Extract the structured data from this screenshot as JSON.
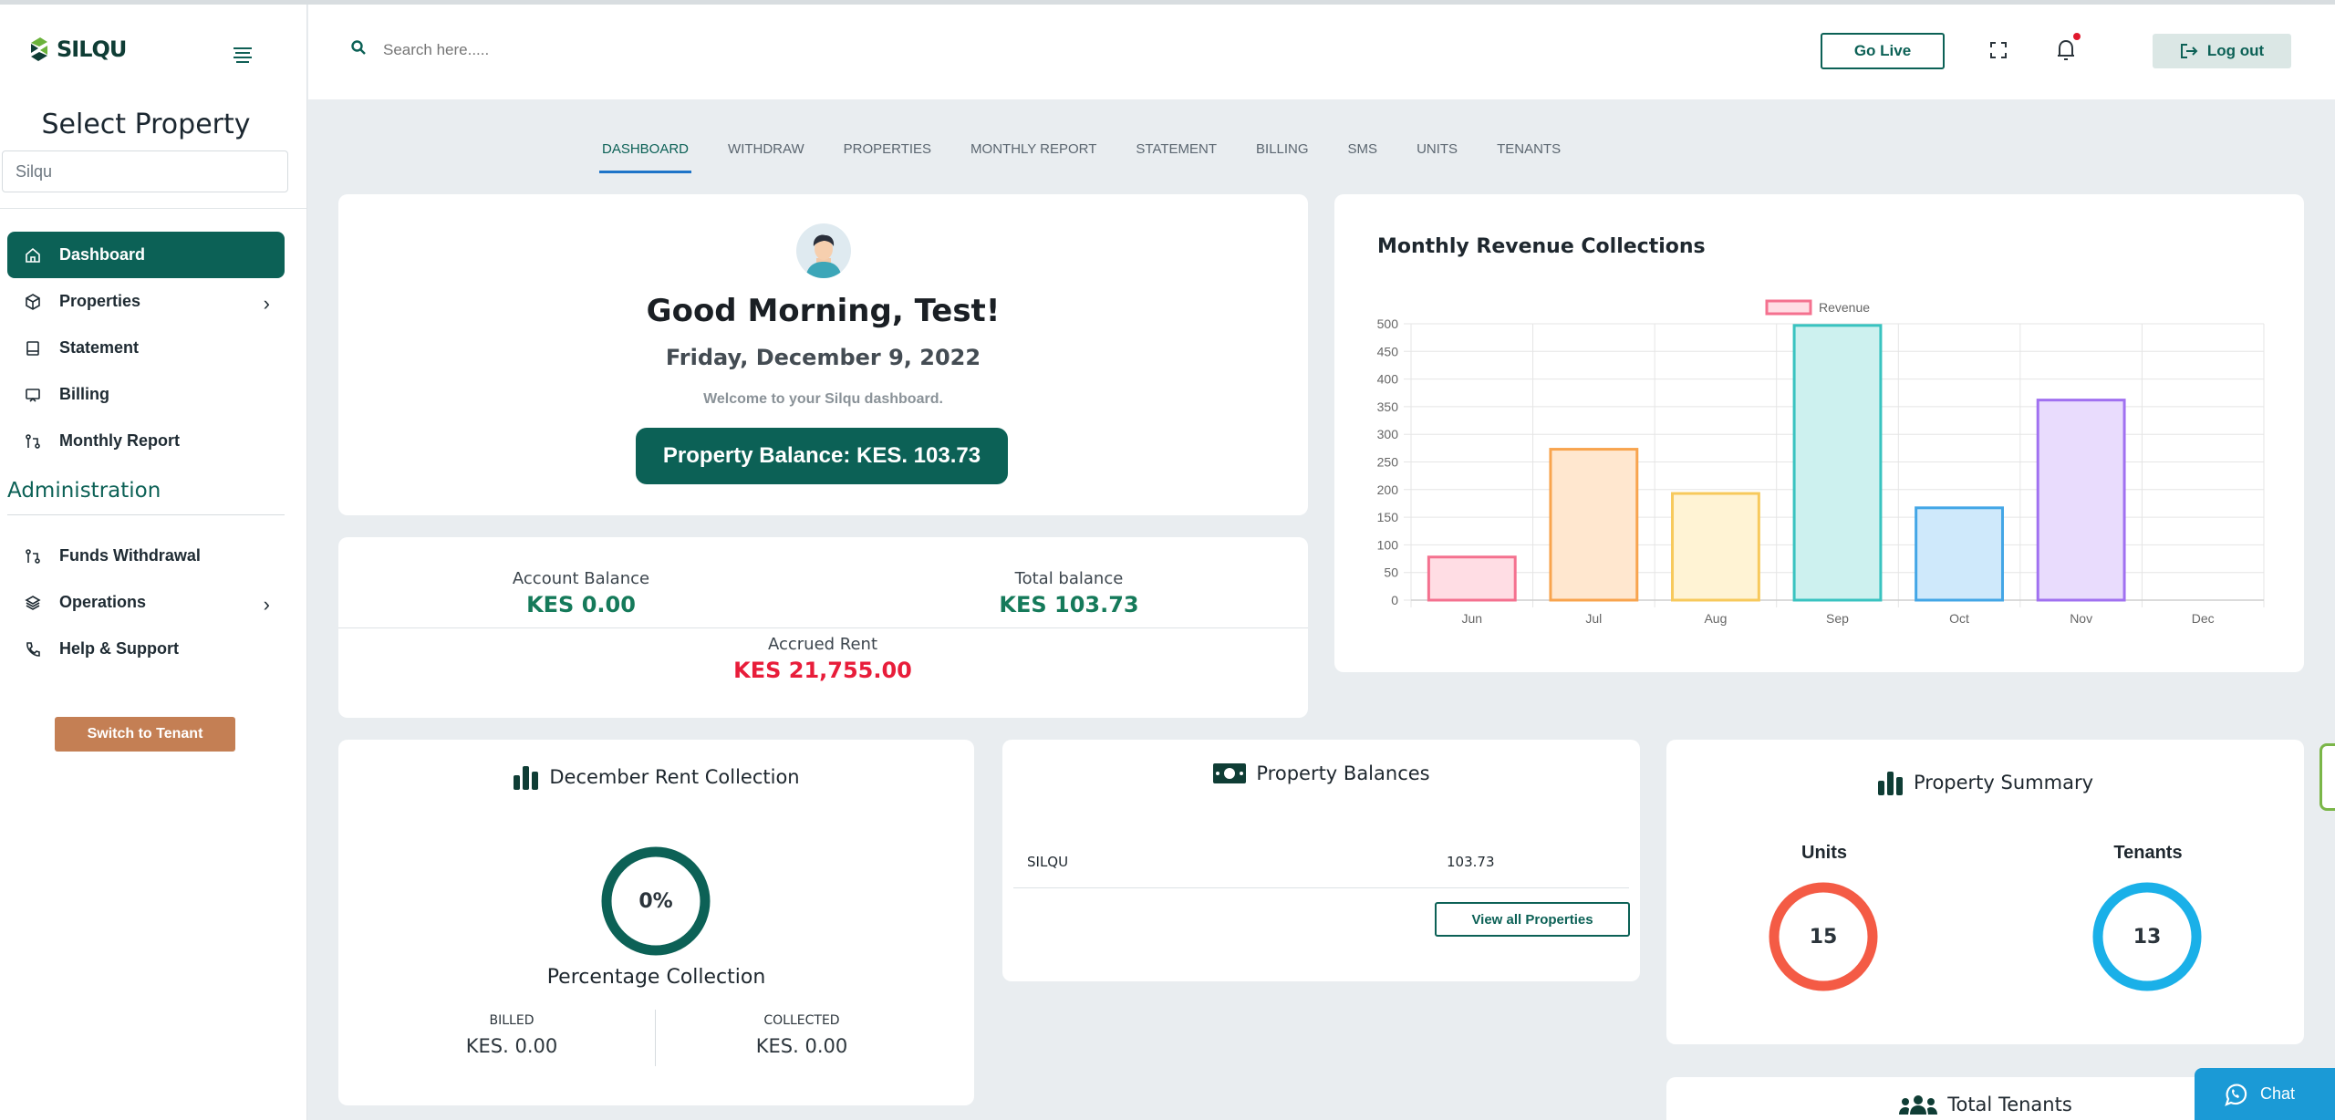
{
  "brand": {
    "name": "SILQU",
    "tagline": ""
  },
  "sidebar": {
    "select_title": "Select Property",
    "property_input_value": "Silqu",
    "nav": [
      {
        "label": "Dashboard",
        "icon": "home-icon"
      },
      {
        "label": "Properties",
        "icon": "box-icon"
      },
      {
        "label": "Statement",
        "icon": "book-icon"
      },
      {
        "label": "Billing",
        "icon": "monitor-icon"
      },
      {
        "label": "Monthly Report",
        "icon": "git-icon"
      }
    ],
    "admin_title": "Administration",
    "admin_nav": [
      {
        "label": "Funds Withdrawal",
        "icon": "git-icon"
      },
      {
        "label": "Operations",
        "icon": "layers-icon"
      },
      {
        "label": "Help & Support",
        "icon": "phone-icon"
      }
    ],
    "switch_label": "Switch to Tenant"
  },
  "header": {
    "search_placeholder": "Search here.....",
    "go_live": "Go Live",
    "logout": "Log out"
  },
  "tabs": [
    "DASHBOARD",
    "WITHDRAW",
    "PROPERTIES",
    "MONTHLY REPORT",
    "STATEMENT",
    "BILLING",
    "SMS",
    "UNITS",
    "TENANTS"
  ],
  "welcome": {
    "greeting": "Good Morning, Test!",
    "date": "Friday, December 9, 2022",
    "subtitle": "Welcome to your Silqu dashboard.",
    "balance": "Property Balance: KES. 103.73"
  },
  "balances": {
    "account_label": "Account Balance",
    "account_value": "KES 0.00",
    "total_label": "Total balance",
    "total_value": "KES 103.73",
    "accrued_label": "Accrued Rent",
    "accrued_value": "KES 21,755.00"
  },
  "chart_data": {
    "type": "bar",
    "title": "Monthly Revenue Collections",
    "categories": [
      "Jun",
      "Jul",
      "Aug",
      "Sep",
      "Oct",
      "Nov",
      "Dec"
    ],
    "series": [
      {
        "name": "Revenue",
        "values": [
          78,
          273,
          193,
          497,
          167,
          362,
          0
        ]
      }
    ],
    "ylim": [
      0,
      500
    ],
    "yticks": [
      0,
      50,
      100,
      150,
      200,
      250,
      300,
      350,
      400,
      450,
      500
    ],
    "grid": true,
    "legend_position": "top",
    "colors": [
      {
        "fill": "#ffdde4",
        "stroke": "#f4718f"
      },
      {
        "fill": "#ffe7cf",
        "stroke": "#f8a44e"
      },
      {
        "fill": "#fff3d4",
        "stroke": "#f7c95c"
      },
      {
        "fill": "#cdf1ef",
        "stroke": "#39c3c0"
      },
      {
        "fill": "#cfe9fb",
        "stroke": "#43a6e6"
      },
      {
        "fill": "#e9dcfd",
        "stroke": "#a071f0"
      },
      {
        "fill": "#eeeeee",
        "stroke": "#c9cbcf"
      }
    ]
  },
  "rent": {
    "title": "December Rent Collection",
    "percent": "0%",
    "percent_value": 0,
    "subtitle": "Percentage Collection",
    "billed_label": "BILLED",
    "billed_value": "KES. 0.00",
    "collected_label": "COLLECTED",
    "collected_value": "KES. 0.00"
  },
  "property_balances": {
    "title": "Property Balances",
    "rows": [
      {
        "name": "SILQU",
        "value": "103.73"
      }
    ],
    "view_all": "View all Properties"
  },
  "summary": {
    "title": "Property Summary",
    "units_label": "Units",
    "units_value": "15",
    "tenants_label": "Tenants",
    "tenants_value": "13"
  },
  "total_tenants": {
    "title": "Total Tenants"
  },
  "chat": {
    "label": "Chat"
  },
  "theme": {
    "primary": "#0c6156",
    "accent_orange": "#c47f54",
    "danger": "#e81d3a",
    "units_ring": "#f45b45",
    "tenants_ring": "#1ab0e8"
  }
}
